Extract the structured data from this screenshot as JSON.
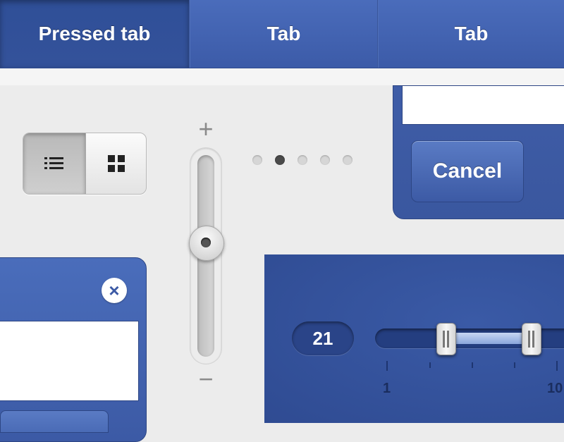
{
  "tabs": [
    {
      "label": "Pressed tab",
      "pressed": true
    },
    {
      "label": "Tab",
      "pressed": false
    },
    {
      "label": "Tab",
      "pressed": false
    }
  ],
  "view_toggle": {
    "options": [
      "list-icon",
      "grid-icon"
    ],
    "selected": "list-icon"
  },
  "vertical_slider": {
    "plus_label": "+",
    "minus_label": "−"
  },
  "page_indicator": {
    "count": 5,
    "active_index": 1
  },
  "dialog_top_right": {
    "cancel_label": "Cancel"
  },
  "dialog_bottom_left": {
    "close_icon": "close-icon"
  },
  "range_slider": {
    "value_label": "21",
    "tick_min_label": "1",
    "tick_max_label": "10"
  },
  "colors": {
    "accent_blue": "#3c5aa5",
    "dark_blue": "#2f4b92",
    "background": "#ececec"
  }
}
